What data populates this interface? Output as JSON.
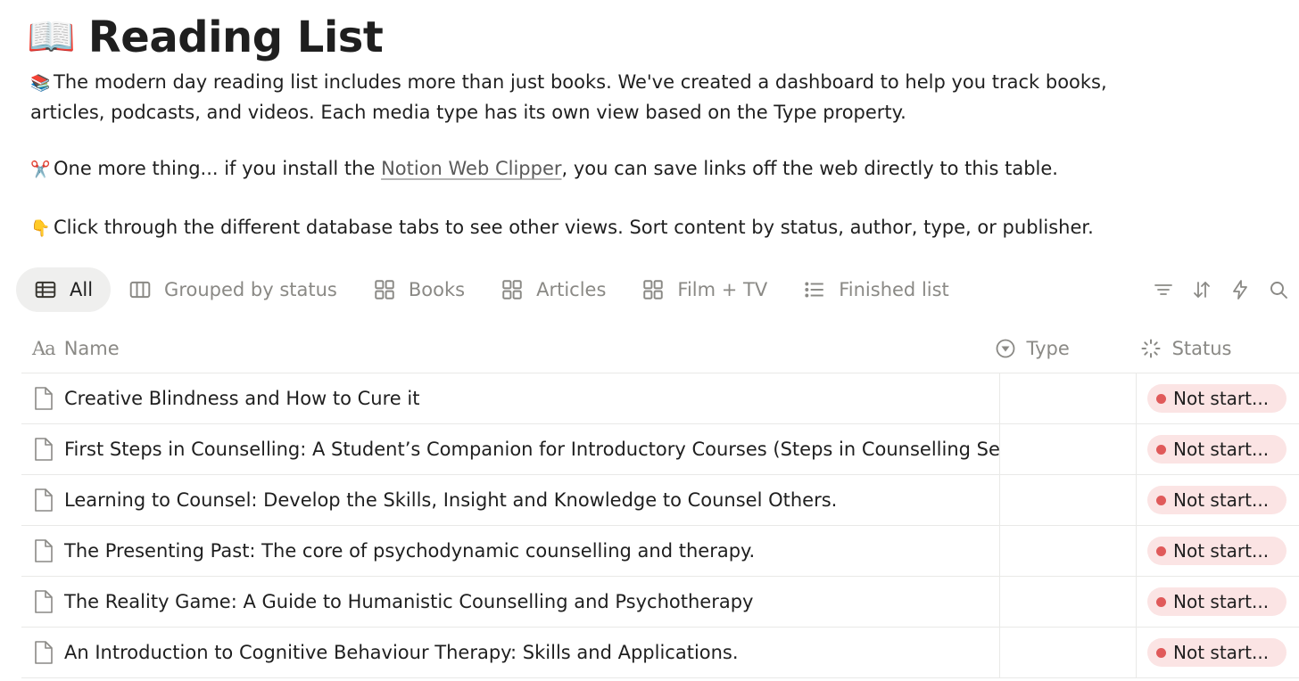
{
  "page": {
    "icon": "📖",
    "title": "Reading List"
  },
  "description": {
    "line1_emoji": "📚",
    "line1": "The modern day reading list includes more than just books. We've created a dashboard to help you track books,",
    "line2": "articles, podcasts, and videos. Each media type has its own view based on the Type property.",
    "line3_emoji": "✂️",
    "line3_before": "One more thing... if you install the ",
    "line3_link": "Notion Web Clipper",
    "line3_after": ", you can save links off the web directly to this table.",
    "line4_emoji": "👇",
    "line4": "Click through the different database tabs to see other views. Sort content by status, author, type, or publisher."
  },
  "views": [
    {
      "label": "All",
      "icon": "table-icon",
      "active": true
    },
    {
      "label": "Grouped by status",
      "icon": "board-icon",
      "active": false
    },
    {
      "label": "Books",
      "icon": "gallery-icon",
      "active": false
    },
    {
      "label": "Articles",
      "icon": "gallery-icon",
      "active": false
    },
    {
      "label": "Film + TV",
      "icon": "gallery-icon",
      "active": false
    },
    {
      "label": "Finished list",
      "icon": "list-icon",
      "active": false
    }
  ],
  "toolbar": [
    "filter-icon",
    "sort-icon",
    "automation-icon",
    "search-icon"
  ],
  "table": {
    "columns": {
      "name": "Name",
      "type": "Type",
      "status": "Status"
    },
    "rows": [
      {
        "name": "Creative Blindness and How to Cure it",
        "type": "",
        "status": "Not start..."
      },
      {
        "name": "First Steps in Counselling: A Student’s Companion for Introductory Courses (Steps in Counselling Series)",
        "type": "",
        "status": "Not start..."
      },
      {
        "name": "Learning to Counsel: Develop the Skills, Insight and Knowledge to Counsel Others.",
        "type": "",
        "status": "Not start..."
      },
      {
        "name": "The Presenting Past: The core of psychodynamic counselling and therapy.",
        "type": "",
        "status": "Not start..."
      },
      {
        "name": "The Reality Game: A Guide to Humanistic Counselling and Psychotherapy",
        "type": "",
        "status": "Not start..."
      },
      {
        "name": "An Introduction to Cognitive Behaviour Therapy: Skills and Applications.",
        "type": "",
        "status": "Not start..."
      }
    ]
  },
  "colors": {
    "status_badge_bg": "#fbe4e4",
    "status_dot": "#e05a5a",
    "active_tab_bg": "#efefee"
  }
}
